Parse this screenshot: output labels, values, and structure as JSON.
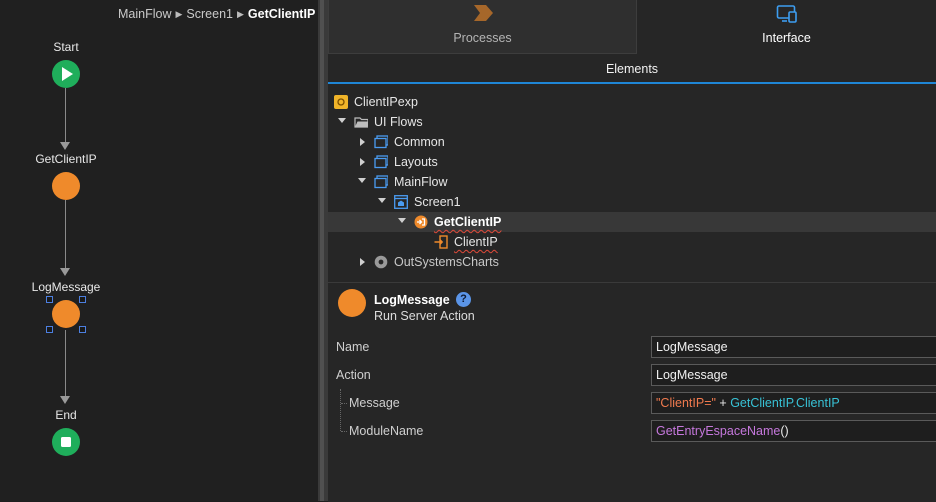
{
  "breadcrumb": {
    "items": [
      "MainFlow",
      "Screen1"
    ],
    "current": "GetClientIP"
  },
  "flow": {
    "start_label": "Start",
    "get_client_ip_label": "GetClientIP",
    "log_message_label": "LogMessage",
    "end_label": "End"
  },
  "tabs": {
    "processes": "Processes",
    "interface": "Interface"
  },
  "elements_label": "Elements",
  "tree": {
    "app": "ClientIPexp",
    "ui_flows": "UI Flows",
    "common": "Common",
    "layouts": "Layouts",
    "mainflow": "MainFlow",
    "screen1": "Screen1",
    "get_client_ip": "GetClientIP",
    "client_ip": "ClientIP",
    "outsystems_charts": "OutSystemsCharts"
  },
  "properties": {
    "title": "LogMessage",
    "help": "?",
    "subtitle": "Run Server Action",
    "name_label": "Name",
    "name_value": "LogMessage",
    "action_label": "Action",
    "action_value": "LogMessage",
    "message_label": "Message",
    "message_string": "\"ClientIP=\"",
    "message_plus": " + ",
    "message_ref": "GetClientIP.ClientIP",
    "module_label": "ModuleName",
    "module_fn": "GetEntryEspaceName",
    "module_parens": "()"
  },
  "colors": {
    "accent": "#1f86d6",
    "node_orange": "#ef8a2b",
    "node_green": "#1fae5b"
  }
}
